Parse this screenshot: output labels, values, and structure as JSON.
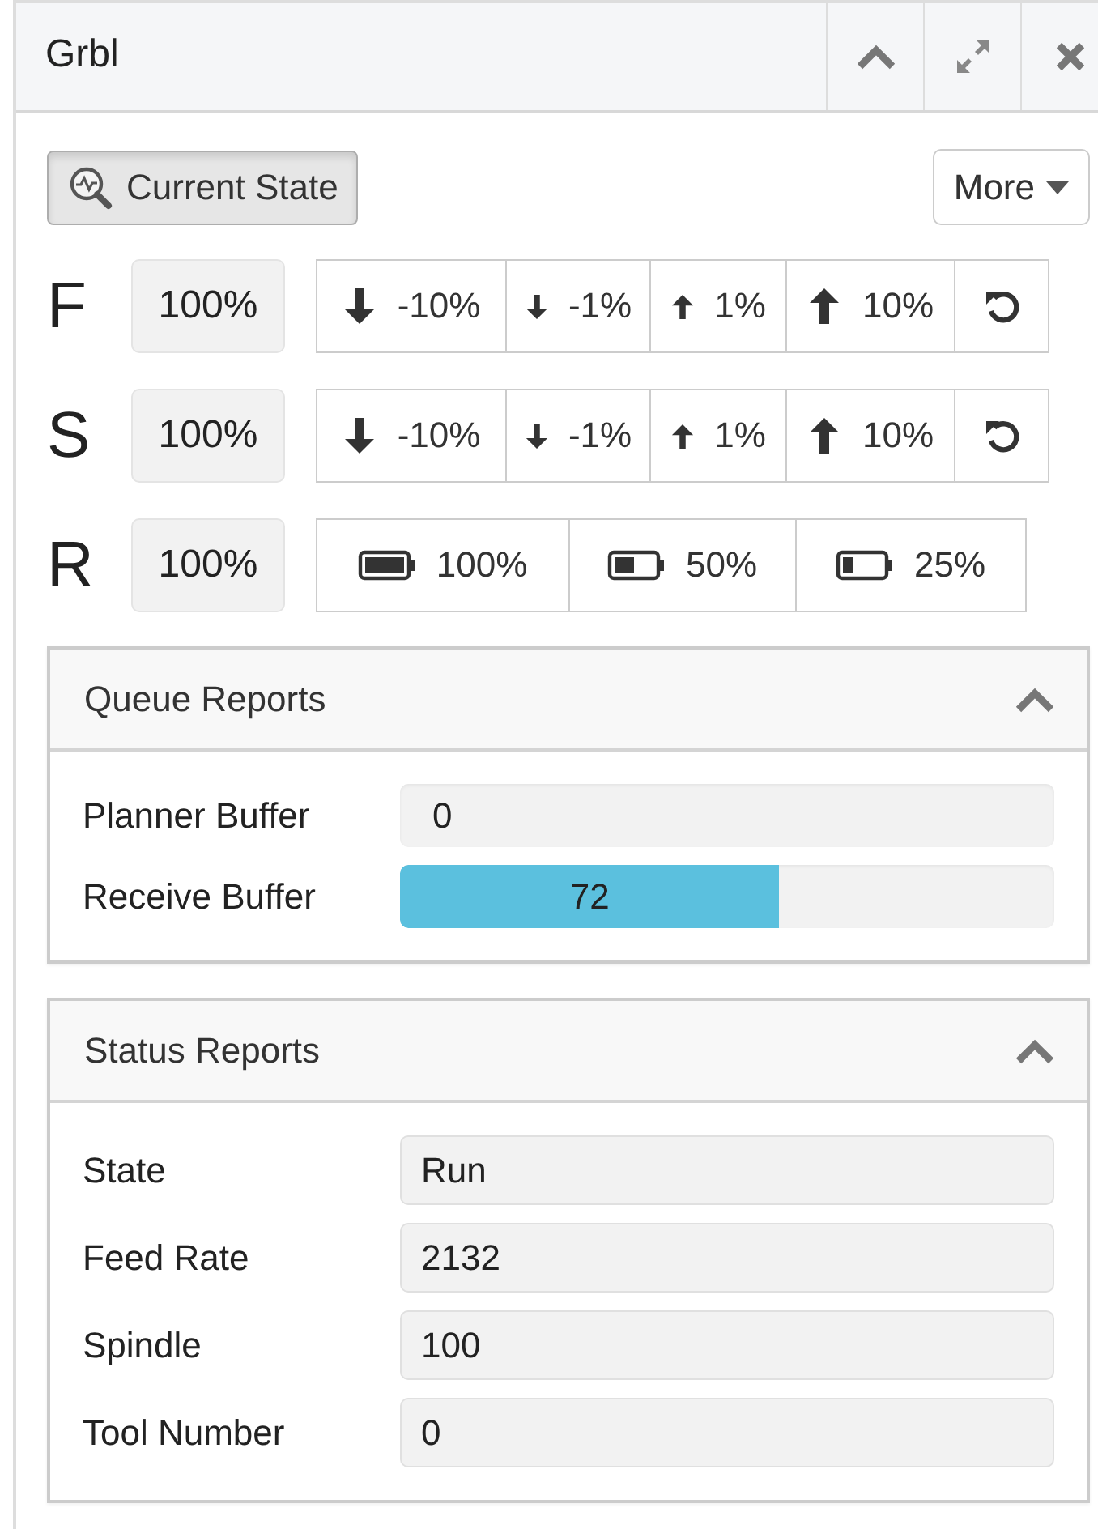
{
  "header": {
    "title": "Grbl"
  },
  "toolbar": {
    "current_state": "Current State",
    "more": "More"
  },
  "overrides": [
    {
      "letter": "F",
      "value": "100%",
      "buttons": [
        {
          "kind": "decrease",
          "label": "-10%"
        },
        {
          "kind": "nudgedown",
          "label": "-1%"
        },
        {
          "kind": "nudgeup",
          "label": "1%"
        },
        {
          "kind": "increase",
          "label": "10%"
        },
        {
          "kind": "reset"
        }
      ]
    },
    {
      "letter": "S",
      "value": "100%",
      "buttons": [
        {
          "kind": "decrease",
          "label": "-10%"
        },
        {
          "kind": "nudgedown",
          "label": "-1%"
        },
        {
          "kind": "nudgeup",
          "label": "1%"
        },
        {
          "kind": "increase",
          "label": "10%"
        },
        {
          "kind": "reset"
        }
      ]
    },
    {
      "letter": "R",
      "value": "100%",
      "buttons": [
        {
          "kind": "full",
          "label": "100%"
        },
        {
          "kind": "half",
          "label": "50%"
        },
        {
          "kind": "quarter",
          "label": "25%"
        }
      ]
    }
  ],
  "queue_reports": {
    "title": "Queue Reports",
    "expanded": true,
    "bars": [
      {
        "label": "Planner Buffer",
        "value": "0",
        "level": 0
      },
      {
        "label": "Receive Buffer",
        "value": "72",
        "level": 0.58
      }
    ]
  },
  "status_reports": {
    "title": "Status Reports",
    "expanded": true,
    "fields": [
      {
        "label": "State",
        "value": "Run"
      },
      {
        "label": "Feed Rate",
        "value": "2132"
      },
      {
        "label": "Spindle",
        "value": "100"
      },
      {
        "label": "Tool Number",
        "value": "0"
      }
    ]
  }
}
